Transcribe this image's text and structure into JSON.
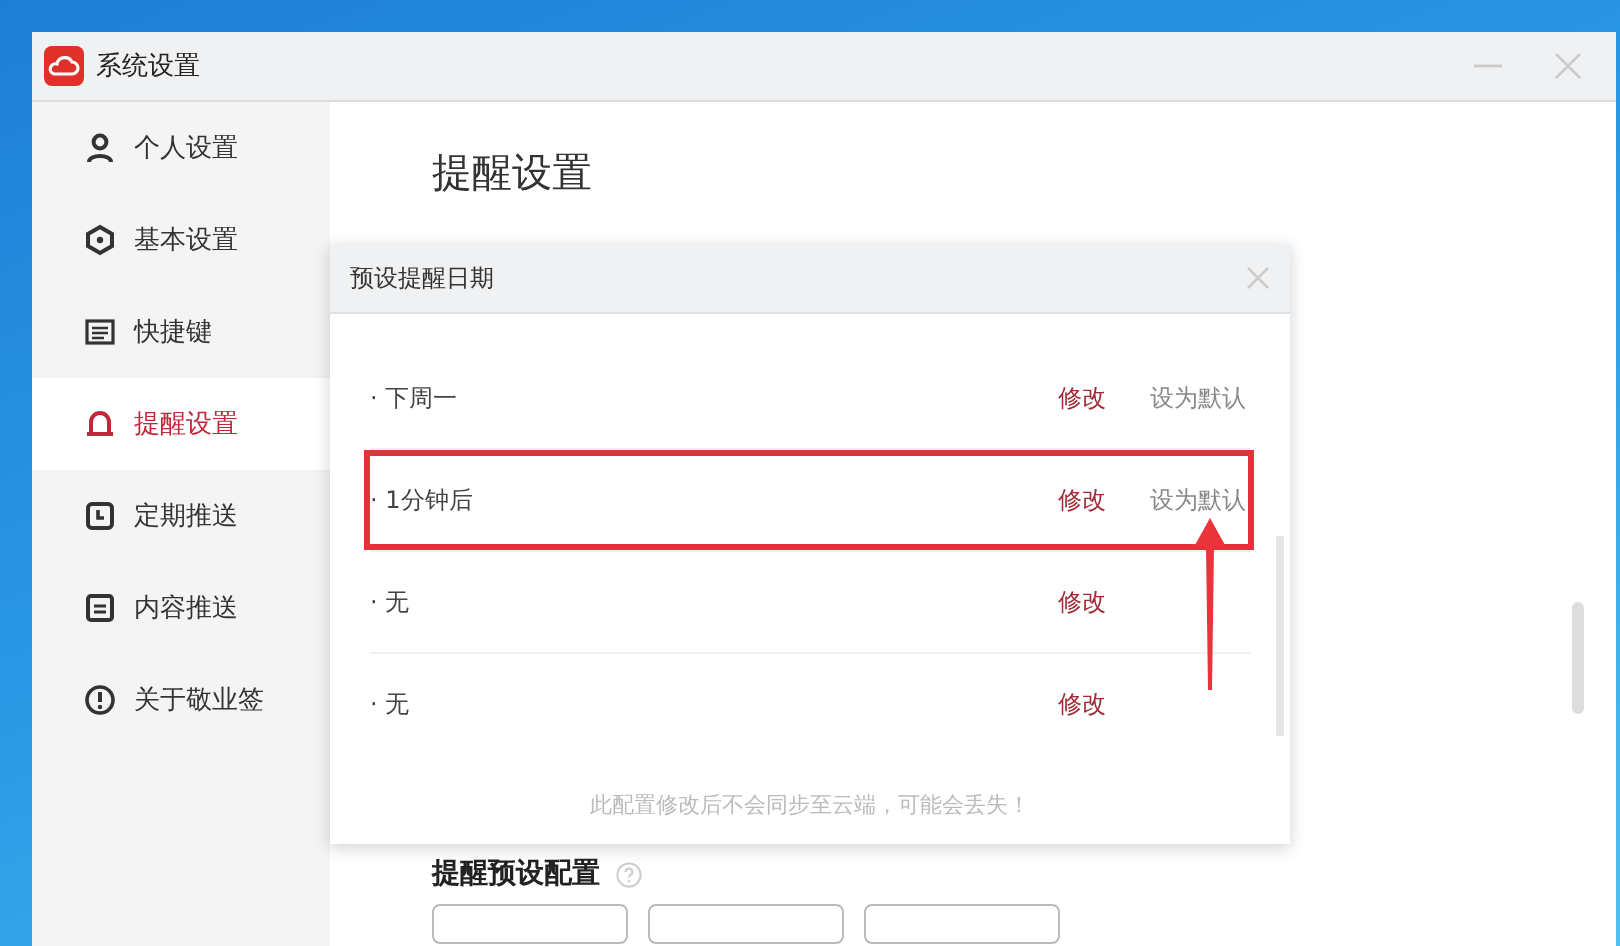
{
  "window": {
    "title": "系统设置"
  },
  "sidebar": {
    "items": [
      {
        "label": "个人设置",
        "selected": false
      },
      {
        "label": "基本设置",
        "selected": false
      },
      {
        "label": "快捷键",
        "selected": false
      },
      {
        "label": "提醒设置",
        "selected": true
      },
      {
        "label": "定期推送",
        "selected": false
      },
      {
        "label": "内容推送",
        "selected": false
      },
      {
        "label": "关于敬业签",
        "selected": false
      }
    ]
  },
  "page": {
    "title": "提醒设置",
    "section_title": "提醒预设配置"
  },
  "dialog": {
    "title": "预设提醒日期",
    "rows": [
      {
        "label": "· 下周一",
        "edit": "修改",
        "set_default": "设为默认",
        "highlighted": false
      },
      {
        "label": "· 1分钟后",
        "edit": "修改",
        "set_default": "设为默认",
        "highlighted": true
      },
      {
        "label": "· 无",
        "edit": "修改",
        "highlighted": false
      },
      {
        "label": "· 无",
        "edit": "修改",
        "highlighted": false
      }
    ],
    "footer": "此配置修改后不会同步至云端，可能会丢失！"
  }
}
